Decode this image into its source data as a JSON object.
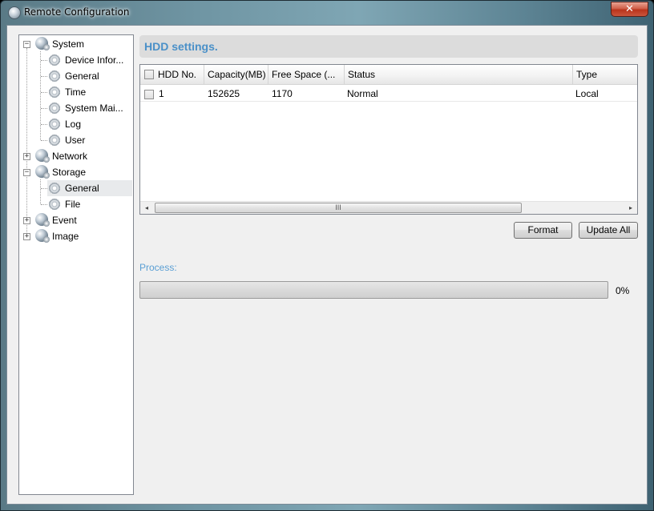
{
  "window": {
    "title": "Remote Configuration",
    "close_glyph": "✕"
  },
  "tree": {
    "system": {
      "label": "System",
      "expander": "−",
      "icon": "globe-icon"
    },
    "system_children": [
      {
        "label": "Device Infor...",
        "icon": "gear-icon"
      },
      {
        "label": "General",
        "icon": "gear-icon"
      },
      {
        "label": "Time",
        "icon": "gear-icon"
      },
      {
        "label": "System Mai...",
        "icon": "gear-icon"
      },
      {
        "label": "Log",
        "icon": "gear-icon"
      },
      {
        "label": "User",
        "icon": "gear-icon"
      }
    ],
    "network": {
      "label": "Network",
      "expander": "+",
      "icon": "globe-icon"
    },
    "storage": {
      "label": "Storage",
      "expander": "−",
      "icon": "globe-icon"
    },
    "storage_children": [
      {
        "label": "General",
        "icon": "gear-icon",
        "selected": true
      },
      {
        "label": "File",
        "icon": "gear-icon"
      }
    ],
    "event": {
      "label": "Event",
      "expander": "+",
      "icon": "globe-icon"
    },
    "image": {
      "label": "Image",
      "expander": "+",
      "icon": "globe-icon"
    }
  },
  "panel": {
    "title": "HDD settings."
  },
  "table": {
    "columns": [
      "HDD No.",
      "Capacity(MB)",
      "Free Space (...",
      "Status",
      "Type"
    ],
    "rows": [
      {
        "hdd_no": "1",
        "capacity": "152625",
        "free_space": "1170",
        "status": "Normal",
        "type": "Local"
      }
    ],
    "scroll": {
      "left": "◂",
      "right": "▸",
      "grip": "III"
    }
  },
  "buttons": {
    "format": "Format",
    "update_all": "Update All"
  },
  "process": {
    "label": "Process:",
    "percent_text": "0%",
    "value": 0
  },
  "colors": {
    "accent": "#4a90c8",
    "process_label": "#5a9fd4",
    "close": "#c9452c"
  }
}
